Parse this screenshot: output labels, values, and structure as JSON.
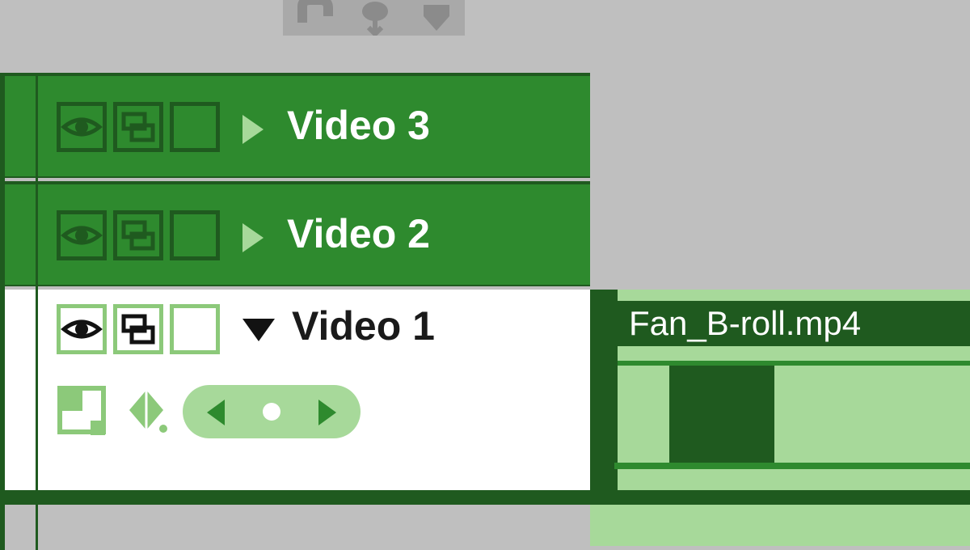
{
  "tracks": [
    {
      "label": "Video 3",
      "expanded": false
    },
    {
      "label": "Video 2",
      "expanded": false
    },
    {
      "label": "Video 1",
      "expanded": true,
      "clip_name": "Fan_B-roll.mp4"
    }
  ],
  "colors": {
    "track_bg": "#2e8a2e",
    "track_border": "#1f5a1f",
    "light_green": "#a7d99a",
    "neutral": "#bfbfbf"
  }
}
